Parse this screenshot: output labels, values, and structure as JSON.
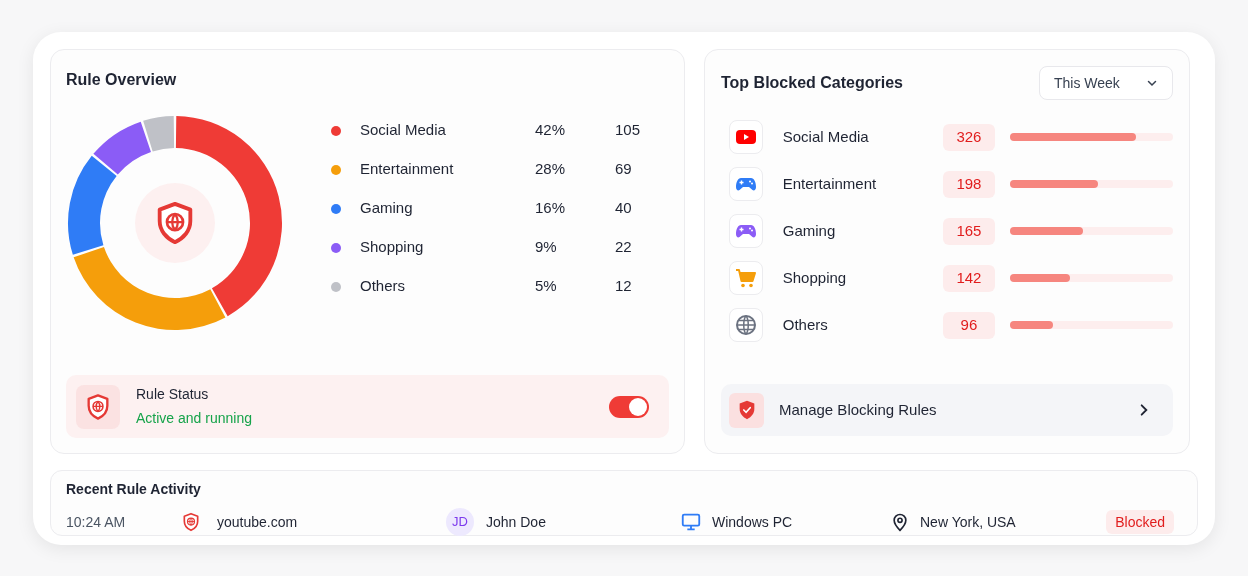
{
  "rule_overview": {
    "title": "Rule Overview",
    "chart_data": {
      "type": "donut",
      "categories": [
        "Social Media",
        "Entertainment",
        "Gaming",
        "Shopping",
        "Others"
      ],
      "values": [
        42,
        28,
        16,
        9,
        5
      ]
    },
    "legend": [
      {
        "color": "#ef3b36",
        "percent": "42%",
        "count": "105"
      },
      {
        "color": "#f59e0b",
        "percent": "28%",
        "count": "69"
      },
      {
        "color": "#2f7cf6",
        "percent": "16%",
        "count": "40"
      },
      {
        "color": "#8b5cf6",
        "percent": "9%",
        "count": "22"
      },
      {
        "color": "#bfc1c7",
        "percent": "5%",
        "count": "12"
      }
    ],
    "status": {
      "label": "Rule Status",
      "value": "Active and running",
      "on": true
    }
  },
  "top_blocked": {
    "title": "Top Blocked Categories",
    "period": "This Week",
    "items": [
      {
        "kind": "video",
        "name": "Social Media",
        "count": "326",
        "level": 0.77
      },
      {
        "kind": "gamepad-blue",
        "name": "Entertainment",
        "count": "198",
        "level": 0.54
      },
      {
        "kind": "gamepad-purple",
        "name": "Gaming",
        "count": "165",
        "level": 0.45
      },
      {
        "kind": "cart",
        "name": "Shopping",
        "count": "142",
        "level": 0.37
      },
      {
        "kind": "globe",
        "name": "Others",
        "count": "96",
        "level": 0.26
      }
    ],
    "manage": "Manage Blocking Rules"
  },
  "recent_activity": {
    "title": "Recent Rule Activity",
    "rows": [
      {
        "time": "10:24 AM",
        "site": "youtube.com",
        "initials": "JD",
        "user": "John Doe",
        "device": "Windows PC",
        "location": "New York, USA",
        "status": "Blocked"
      }
    ]
  }
}
